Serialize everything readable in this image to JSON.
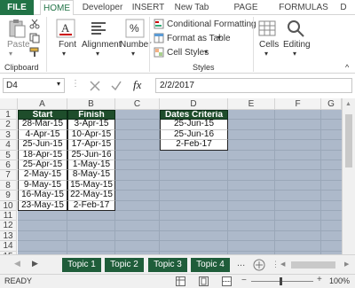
{
  "ribbon_tabs": [
    "FILE",
    "HOME",
    "Developer",
    "INSERT",
    "New Tab",
    "PAGE LAYOUT",
    "FORMULAS",
    "D"
  ],
  "ribbon": {
    "paste": "Paste",
    "clipboard": "Clipboard",
    "font": "Font",
    "alignment": "Alignment",
    "number": "Number",
    "conditional_formatting": "Conditional Formatting",
    "format_as_table": "Format as Table",
    "cell_styles": "Cell Styles",
    "styles": "Styles",
    "cells": "Cells",
    "editing": "Editing"
  },
  "formula_bar": {
    "name_box": "D4",
    "fx_label": "fx",
    "value": "2/2/2017"
  },
  "columns": [
    "A",
    "B",
    "C",
    "D",
    "E",
    "F",
    "G"
  ],
  "rows": [
    "1",
    "2",
    "3",
    "4",
    "5",
    "6",
    "7",
    "8",
    "9",
    "10",
    "11",
    "12",
    "13",
    "14",
    "15"
  ],
  "table": {
    "headers": [
      "Start",
      "Finish"
    ],
    "rows": [
      [
        "28-Mar-15",
        "3-Apr-15"
      ],
      [
        "4-Apr-15",
        "10-Apr-15"
      ],
      [
        "25-Jun-15",
        "17-Apr-15"
      ],
      [
        "18-Apr-15",
        "25-Jun-16"
      ],
      [
        "25-Apr-15",
        "1-May-15"
      ],
      [
        "2-May-15",
        "8-May-15"
      ],
      [
        "9-May-15",
        "15-May-15"
      ],
      [
        "16-May-15",
        "22-May-15"
      ],
      [
        "23-May-15",
        "2-Feb-17"
      ]
    ]
  },
  "criteria": {
    "header": "Dates Criteria",
    "values": [
      "25-Jun-15",
      "25-Jun-16",
      "2-Feb-17"
    ]
  },
  "sheet_tabs": [
    "Topic 1",
    "Topic 2",
    "Topic 3",
    "Topic 4"
  ],
  "sheet_more": "...",
  "status": {
    "mode": "READY",
    "zoom": "100%"
  },
  "colors": {
    "excel_green": "#217346",
    "header_fill": "#1e4d2b",
    "sheet_background": "#adb9ca",
    "tab_fill": "#1f5d3a"
  }
}
